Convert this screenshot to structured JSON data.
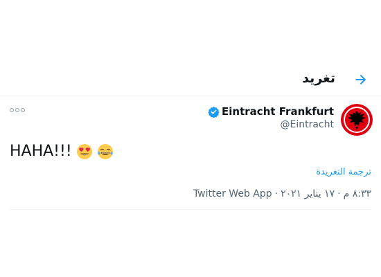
{
  "header": {
    "title": "تغريد",
    "back_icon": "arrow-right-icon"
  },
  "tweet": {
    "author_name": "Eintracht Frankfurt",
    "author_handle": "@Eintracht",
    "verified": true,
    "text": "HAHA!!!",
    "emojis": [
      "heart-eyes-emoji",
      "tears-of-joy-emoji"
    ],
    "translate_label": "ترجمة التغريدة",
    "time": "٨:٣٣ م",
    "separator": "·",
    "date": "١٧ يناير ٢٠٢١",
    "source": "Twitter Web App"
  },
  "colors": {
    "accent": "#1d9bf0",
    "secondary_text": "#536471",
    "avatar_red": "#e1000f"
  }
}
